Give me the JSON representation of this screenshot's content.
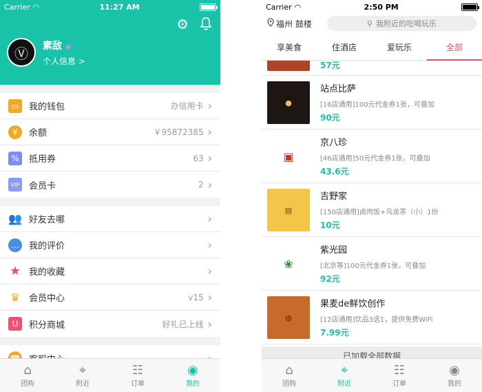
{
  "left": {
    "status": {
      "carrier": "Carrier",
      "time": "11:27 AM"
    },
    "profile": {
      "name": "素敌",
      "info_link": "个人信息 >"
    },
    "groups": [
      [
        {
          "label": "我的钱包",
          "value": "办信用卡",
          "icon": "wallet-icon"
        },
        {
          "label": "余额",
          "value": "￥95872385",
          "icon": "money-bag-icon"
        },
        {
          "label": "抵用券",
          "value": "63",
          "icon": "coupon-icon"
        },
        {
          "label": "会员卡",
          "value": "2",
          "icon": "vip-card-icon"
        }
      ],
      [
        {
          "label": "好友去哪",
          "value": "",
          "icon": "friends-icon"
        },
        {
          "label": "我的评价",
          "value": "",
          "icon": "comment-icon"
        },
        {
          "label": "我的收藏",
          "value": "",
          "icon": "star-icon"
        },
        {
          "label": "会员中心",
          "value": "v15",
          "icon": "crown-icon"
        },
        {
          "label": "积分商城",
          "value": "好礼已上线",
          "icon": "mall-icon"
        }
      ],
      [
        {
          "label": "客服中心",
          "value": "",
          "icon": "service-icon"
        }
      ]
    ],
    "tabs": [
      {
        "label": "团购",
        "icon": "home-icon"
      },
      {
        "label": "附近",
        "icon": "location-pin-icon"
      },
      {
        "label": "订单",
        "icon": "order-icon"
      },
      {
        "label": "我的",
        "icon": "profile-icon"
      }
    ]
  },
  "right": {
    "status": {
      "carrier": "Carrier",
      "time": "2:50 PM"
    },
    "location": "福州 鼓楼",
    "search_placeholder": "我附近的吃喝玩乐",
    "categories": [
      "享美食",
      "住酒店",
      "爱玩乐",
      "全部"
    ],
    "first_price": "57元",
    "items": [
      {
        "name": "站点比萨",
        "desc": "[16店通用]100元代金券1张，可叠加",
        "price": "90元"
      },
      {
        "name": "京八珍",
        "desc": "[46店通用]50元代金券1张，可叠加",
        "price": "43.6元"
      },
      {
        "name": "吉野家",
        "desc": "[150店通用]卤肉饭+乌龙茶（小）1份",
        "price": "10元"
      },
      {
        "name": "紫光园",
        "desc": "[北京等]100元代金券1张，可叠加",
        "price": "92元"
      },
      {
        "name": "果麦de鲜饮创作",
        "desc": "[12店通用]饮品3选1，提供免费WiFi",
        "price": "7.99元"
      }
    ],
    "loaded_text": "已加载全部数据",
    "tabs": [
      {
        "label": "团购",
        "icon": "home-icon"
      },
      {
        "label": "附近",
        "icon": "location-pin-icon"
      },
      {
        "label": "订单",
        "icon": "order-icon"
      },
      {
        "label": "我的",
        "icon": "profile-icon"
      }
    ]
  },
  "colors": {
    "accent": "#19c3a8",
    "category_active": "#e84c60"
  }
}
